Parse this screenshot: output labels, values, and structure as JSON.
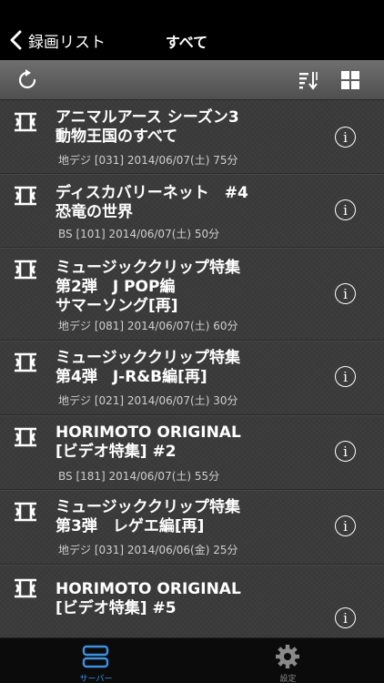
{
  "nav": {
    "back_label": "録画リスト",
    "title": "すべて"
  },
  "toolbar": {
    "refresh_icon": "refresh-icon",
    "sort_icon": "sort-icon",
    "grid_icon": "grid-icon"
  },
  "recordings": [
    {
      "title": "アニマルアース シーズン3\n動物王国のすべて",
      "meta": "地デジ [031] 2014/06/07(土)  75分"
    },
    {
      "title": "ディスカバリーネット　#4\n恐竜の世界",
      "meta": "BS [101] 2014/06/07(土)  50分"
    },
    {
      "title": "ミュージッククリップ特集\n第2弾　J POP編\nサマーソング[再]",
      "meta": "地デジ [081] 2014/06/07(土)  60分"
    },
    {
      "title": "ミュージッククリップ特集\n第4弾　J-R&B編[再]",
      "meta": "地デジ [021] 2014/06/07(土)  30分"
    },
    {
      "title": "HORIMOTO ORIGINAL\n[ビデオ特集] #2",
      "meta": "BS [181] 2014/06/07(土)  55分"
    },
    {
      "title": "ミュージッククリップ特集\n第3弾　レゲエ編[再]",
      "meta": "地デジ [031] 2014/06/06(金)  25分"
    },
    {
      "title": "HORIMOTO ORIGINAL\n[ビデオ特集] #5",
      "meta": ""
    }
  ],
  "info_glyph": "i",
  "tabs": {
    "server": {
      "label": "サーバー",
      "icon": "server-icon",
      "active": true
    },
    "settings": {
      "label": "設定",
      "icon": "gear-icon",
      "active": false
    }
  },
  "colors": {
    "accent": "#3d8fe0",
    "toolbar": "#5f5f5f",
    "list_bg": "#3b3b3b"
  }
}
